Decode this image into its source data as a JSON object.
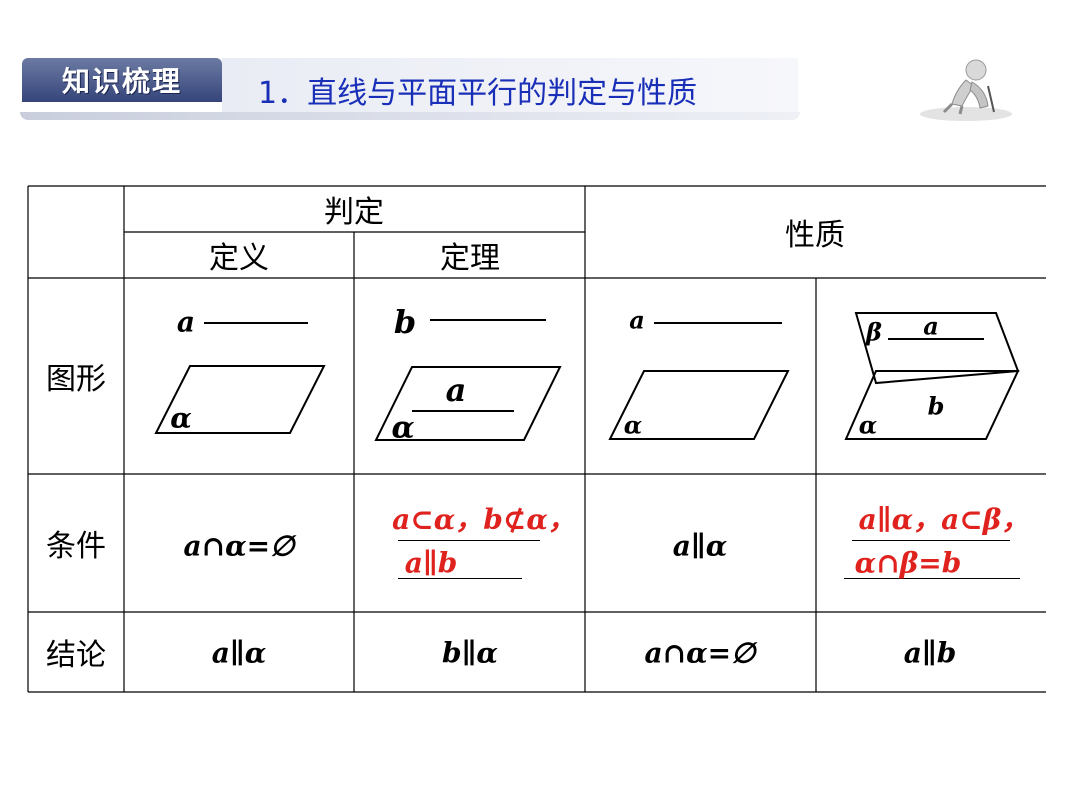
{
  "header": {
    "badge": "知识梳理",
    "title": "1．直线与平面平行的判定与性质"
  },
  "table": {
    "col_headers": {
      "judgment": "判定",
      "definition": "定义",
      "theorem": "定理",
      "property": "性质"
    },
    "row_headers": {
      "figure": "图形",
      "condition": "条件",
      "conclusion": "结论"
    },
    "figure_labels": {
      "def_line": "a",
      "def_plane": "α",
      "thm_line_out": "b",
      "thm_line_in": "a",
      "thm_plane": "α",
      "prop1_line": "a",
      "prop1_plane": "α",
      "prop2_beta": "β",
      "prop2_line_a": "a",
      "prop2_line_b": "b",
      "prop2_alpha": "α"
    },
    "conditions": {
      "definition": "a∩α=∅",
      "theorem_line1": "a⊂α，b⊄α，",
      "theorem_line2": "a∥b",
      "property1": "a∥α",
      "property2_line1": "a∥α，a⊂β，",
      "property2_line2": "α∩β=b"
    },
    "conclusions": {
      "definition": "a∥α",
      "theorem": "b∥α",
      "property1": "a∩α=∅",
      "property2": "a∥b"
    }
  },
  "colors": {
    "title_blue": "#1a2fb8",
    "answer_red": "#e0221f",
    "badge_blue": "#35457a"
  }
}
